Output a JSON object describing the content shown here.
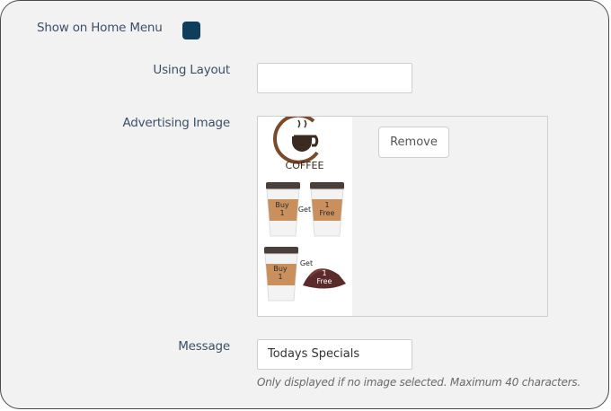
{
  "settings": {
    "show_on_home_menu_label": "Show on Home Menu",
    "show_on_home_menu_checked": true,
    "using_layout_label": "Using Layout",
    "using_layout_value": "",
    "advertising_image_label": "Advertising Image",
    "remove_button": "Remove",
    "image": {
      "logo_text": "COFFEE",
      "cup1_text": "Buy\n1",
      "get1_text": "Get",
      "cup2_text": "1\nFree",
      "cup3_text": "Buy\n1",
      "get2_text": "Get",
      "cake_text": "1\nFree"
    },
    "message_label": "Message",
    "message_value": "Todays Specials",
    "message_hint": "Only displayed if no image selected. Maximum 40 characters."
  },
  "colors": {
    "checkbox": "#0d3f5c",
    "label": "#3b5068"
  }
}
